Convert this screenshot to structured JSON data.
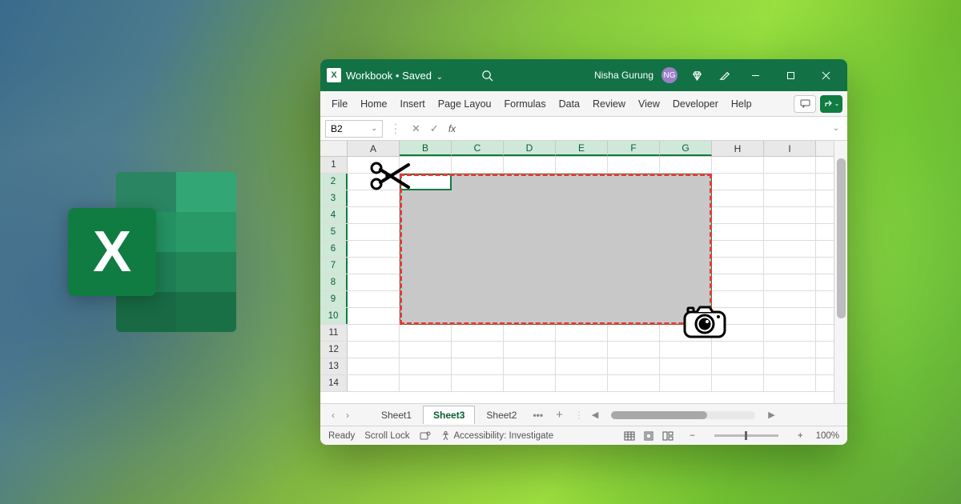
{
  "titlebar": {
    "workbook": "Workbook",
    "saved": "Saved",
    "user_name": "Nisha Gurung",
    "user_initials": "NG"
  },
  "ribbon": {
    "tabs": [
      "File",
      "Home",
      "Insert",
      "Page Layou",
      "Formulas",
      "Data",
      "Review",
      "View",
      "Developer",
      "Help"
    ]
  },
  "formula_bar": {
    "cell_ref": "B2",
    "fx_label": "fx",
    "value": ""
  },
  "grid": {
    "columns": [
      "A",
      "B",
      "C",
      "D",
      "E",
      "F",
      "G",
      "H",
      "I"
    ],
    "selected_cols": [
      "B",
      "C",
      "D",
      "E",
      "F",
      "G"
    ],
    "rows": [
      1,
      2,
      3,
      4,
      5,
      6,
      7,
      8,
      9,
      10,
      11,
      12,
      13,
      14
    ],
    "selected_rows": [
      2,
      3,
      4,
      5,
      6,
      7,
      8,
      9,
      10
    ],
    "active_cell": "B2"
  },
  "sheets": {
    "items": [
      "Sheet1",
      "Sheet3",
      "Sheet2"
    ],
    "active": "Sheet3"
  },
  "status": {
    "ready": "Ready",
    "scroll_lock": "Scroll Lock",
    "accessibility": "Accessibility: Investigate",
    "zoom": "100%"
  },
  "logo": {
    "x": "X"
  }
}
